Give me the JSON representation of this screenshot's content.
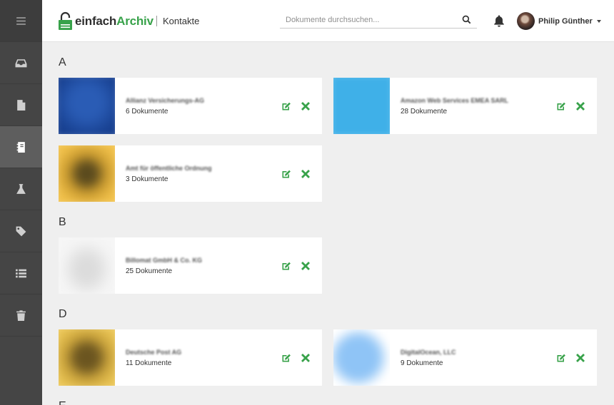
{
  "header": {
    "logo_part1": "einfach",
    "logo_part2": "Archiv",
    "page_title": "Kontakte",
    "search_placeholder": "Dokumente durchsuchen...",
    "user_name": "Philip Günther"
  },
  "sidebar": {
    "items": [
      {
        "icon": "menu-icon"
      },
      {
        "icon": "inbox-icon"
      },
      {
        "icon": "document-icon"
      },
      {
        "icon": "contacts-book-icon",
        "active": true
      },
      {
        "icon": "flask-icon"
      },
      {
        "icon": "tag-icon"
      },
      {
        "icon": "list-icon"
      },
      {
        "icon": "trash-icon"
      }
    ]
  },
  "groups": [
    {
      "letter": "A"
    },
    {
      "letter": "B"
    },
    {
      "letter": "D"
    },
    {
      "letter": "E"
    }
  ],
  "contacts": [
    {
      "name": "Allianz Versicherungs-AG",
      "count": "6 Dokumente",
      "thumb_color": "#1f4ea3"
    },
    {
      "name": "Amazon Web Services EMEA SARL",
      "count": "28 Dokumente",
      "thumb_color": "#3fb0e8"
    },
    {
      "name": "Amt für öffentliche Ordnung",
      "count": "3 Dokumente",
      "thumb_color": "#f0c048"
    },
    {
      "name": "Billomat GmbH & Co. KG",
      "count": "25 Dokumente",
      "thumb_color": "#f2f2f2"
    },
    {
      "name": "Deutsche Post AG",
      "count": "11 Dokumente",
      "thumb_color": "#e8c24c"
    },
    {
      "name": "DigitalOcean, LLC",
      "count": "9 Dokumente",
      "thumb_color": "#8fc4f6"
    }
  ],
  "colors": {
    "accent_green": "#38a24a",
    "sidebar_bg": "#454545",
    "sidebar_active": "#5e5e5e"
  }
}
